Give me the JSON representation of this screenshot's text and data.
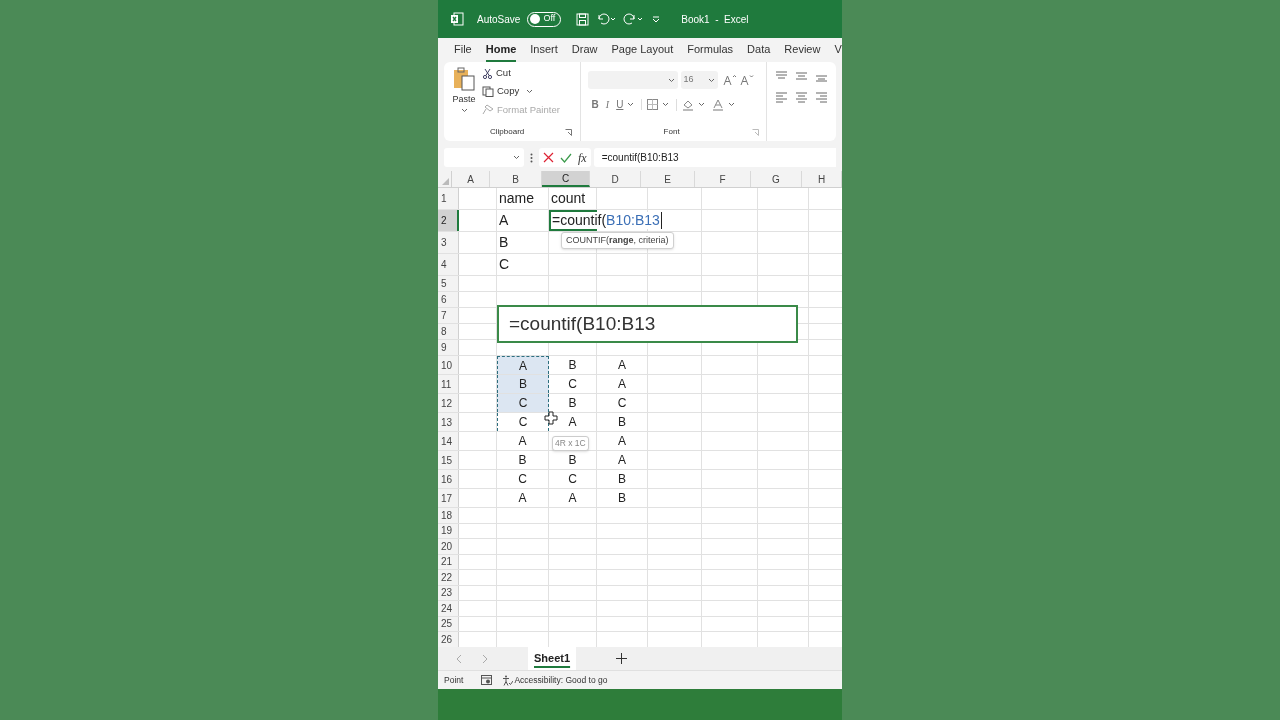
{
  "title_bar": {
    "autosave_label": "AutoSave",
    "autosave": {
      "label": "Off",
      "on": false
    },
    "title": "Book1  -  Excel"
  },
  "menu_tabs": [
    {
      "label": "File",
      "selected": false
    },
    {
      "label": "Home",
      "selected": true
    },
    {
      "label": "Insert",
      "selected": false
    },
    {
      "label": "Draw",
      "selected": false
    },
    {
      "label": "Page Layout",
      "selected": false
    },
    {
      "label": "Formulas",
      "selected": false
    },
    {
      "label": "Data",
      "selected": false
    },
    {
      "label": "Review",
      "selected": false
    },
    {
      "label": "V",
      "selected": false
    }
  ],
  "ribbon": {
    "clipboard": {
      "paste": "Paste",
      "cut": {
        "label": "Cut",
        "disabled": false
      },
      "copy": {
        "label": "Copy",
        "disabled": false
      },
      "format_painter": {
        "label": "Format Painter",
        "disabled": true
      },
      "group_label": "Clipboard"
    },
    "font": {
      "font_size": "16",
      "bold": "B",
      "italic": "I",
      "underline": "U",
      "group_label": "Font"
    }
  },
  "formula_bar": {
    "fx": "fx",
    "formula": "=countif(B10:B13"
  },
  "columns": [
    {
      "label": "A",
      "selected": false
    },
    {
      "label": "B",
      "selected": false
    },
    {
      "label": "C",
      "selected": true
    },
    {
      "label": "D",
      "selected": false
    },
    {
      "label": "E",
      "selected": false
    },
    {
      "label": "F",
      "selected": false
    },
    {
      "label": "G",
      "selected": false
    },
    {
      "label": "H",
      "selected": false
    }
  ],
  "rows": [
    {
      "number": "1",
      "selected": false,
      "cells": [
        {
          "kind": "blank"
        },
        {
          "text": "name"
        },
        {
          "text": "count"
        }
      ]
    },
    {
      "number": "2",
      "selected": true,
      "cells": [
        {
          "kind": "blank"
        },
        {
          "text": "A"
        },
        {
          "kind": "editing",
          "text": "=countif(",
          "reference": "B10:B13"
        }
      ]
    },
    {
      "number": "3",
      "selected": false,
      "cells": [
        {
          "kind": "blank"
        },
        {
          "text": "B"
        }
      ]
    },
    {
      "number": "4",
      "selected": false,
      "cells": [
        {
          "kind": "blank"
        },
        {
          "text": "C"
        }
      ]
    },
    {
      "number": "5",
      "selected": false
    },
    {
      "number": "6",
      "selected": false
    },
    {
      "number": "7",
      "selected": false
    },
    {
      "number": "8",
      "selected": false
    },
    {
      "number": "9",
      "selected": false
    },
    {
      "number": "10",
      "selected": false,
      "cells": [
        {
          "kind": "blank"
        },
        {
          "text": "A",
          "highlighted": true,
          "marquee": true
        },
        {
          "text": "B"
        },
        {
          "text": "A"
        }
      ]
    },
    {
      "number": "11",
      "selected": false,
      "cells": [
        {
          "kind": "blank"
        },
        {
          "text": "B",
          "highlighted": true,
          "marquee": true
        },
        {
          "text": "C"
        },
        {
          "text": "A"
        }
      ]
    },
    {
      "number": "12",
      "selected": false,
      "cells": [
        {
          "kind": "blank"
        },
        {
          "text": "C",
          "highlighted": true,
          "marquee": true
        },
        {
          "text": "B"
        },
        {
          "text": "C"
        }
      ]
    },
    {
      "number": "13",
      "selected": false,
      "cells": [
        {
          "kind": "blank"
        },
        {
          "text": "C",
          "highlighted": false,
          "marquee": true
        },
        {
          "text": "A"
        },
        {
          "text": "B"
        }
      ]
    },
    {
      "number": "14",
      "selected": false,
      "cells": [
        {
          "kind": "blank"
        },
        {
          "text": "A"
        },
        {
          "kind": "blank"
        },
        {
          "text": "A"
        }
      ]
    },
    {
      "number": "15",
      "selected": false,
      "cells": [
        {
          "kind": "blank"
        },
        {
          "text": "B"
        },
        {
          "text": "B"
        },
        {
          "text": "A"
        }
      ]
    },
    {
      "number": "16",
      "selected": false,
      "cells": [
        {
          "kind": "blank"
        },
        {
          "text": "C"
        },
        {
          "text": "C"
        },
        {
          "text": "B"
        }
      ]
    },
    {
      "number": "17",
      "selected": false,
      "cells": [
        {
          "kind": "blank"
        },
        {
          "text": "A"
        },
        {
          "text": "A"
        },
        {
          "text": "B"
        }
      ]
    },
    {
      "number": "18",
      "selected": false
    },
    {
      "number": "19",
      "selected": false
    },
    {
      "number": "20",
      "selected": false
    },
    {
      "number": "21",
      "selected": false
    },
    {
      "number": "22",
      "selected": false
    },
    {
      "number": "23",
      "selected": false
    },
    {
      "number": "24",
      "selected": false
    },
    {
      "number": "25",
      "selected": false
    },
    {
      "number": "26",
      "selected": false
    }
  ],
  "function_tooltip": "COUNTIF(**range**, criteria)",
  "callout": "=countif(B10:B13",
  "selection_size": "4R x 1C",
  "sheet_tabs": [
    {
      "label": "Sheet1",
      "selected": true
    }
  ],
  "status_bar": {
    "mode": "Point",
    "accessibility": "Accessibility: Good to go"
  }
}
